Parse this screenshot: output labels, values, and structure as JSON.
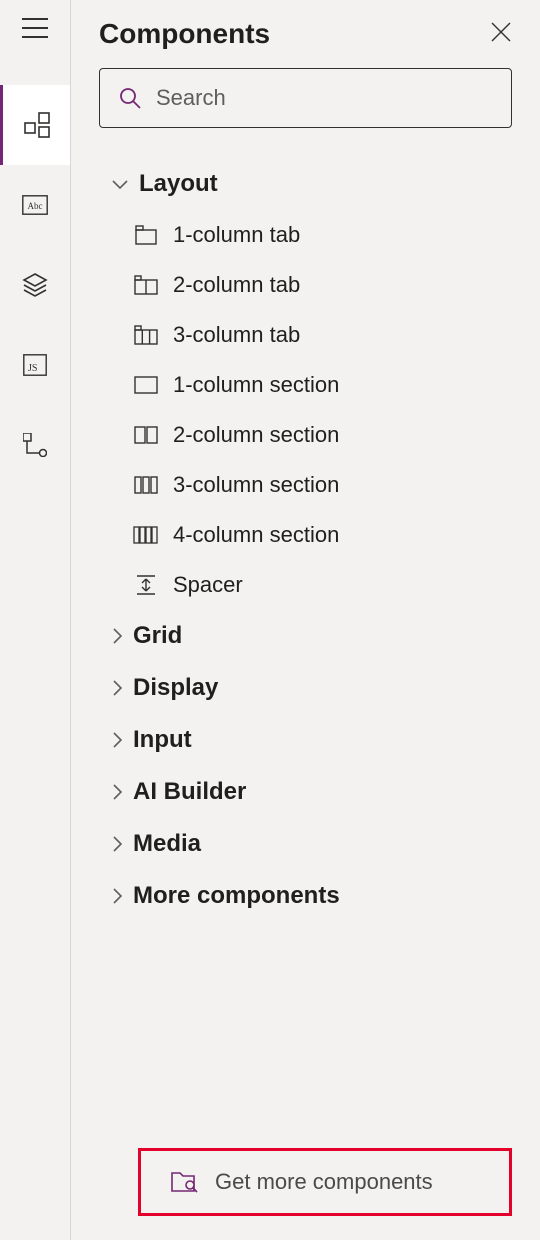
{
  "panel": {
    "title": "Components"
  },
  "search": {
    "placeholder": "Search"
  },
  "categories": {
    "layout": {
      "label": "Layout"
    },
    "grid": {
      "label": "Grid"
    },
    "display": {
      "label": "Display"
    },
    "input": {
      "label": "Input"
    },
    "ai_builder": {
      "label": "AI Builder"
    },
    "media": {
      "label": "Media"
    },
    "more": {
      "label": "More components"
    }
  },
  "layout_items": {
    "col1_tab": "1-column tab",
    "col2_tab": "2-column tab",
    "col3_tab": "3-column tab",
    "col1_section": "1-column section",
    "col2_section": "2-column section",
    "col3_section": "3-column section",
    "col4_section": "4-column section",
    "spacer": "Spacer"
  },
  "footer": {
    "label": "Get more components"
  }
}
